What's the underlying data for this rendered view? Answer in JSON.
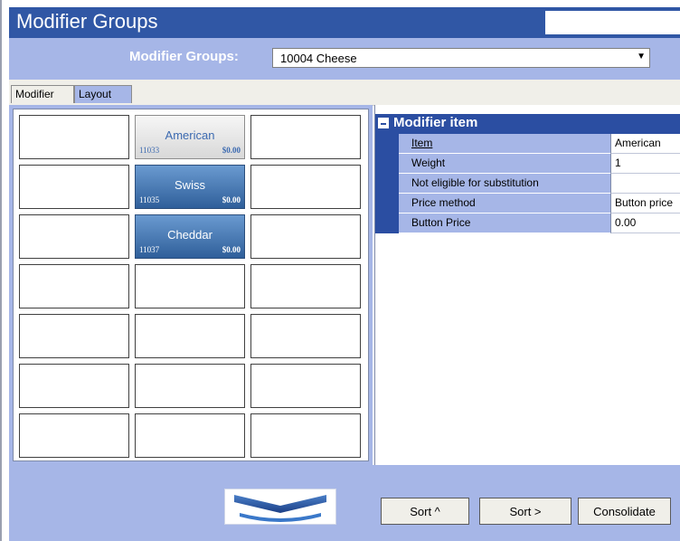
{
  "window": {
    "title": "Modifier Groups"
  },
  "selector": {
    "label": "Modifier Groups:",
    "value": "10004 Cheese"
  },
  "tabs": [
    {
      "label": "Modifier"
    },
    {
      "label": "Layout"
    }
  ],
  "grid": {
    "buttons": [
      {
        "name": "American",
        "code": "11033",
        "price": "$0.00"
      },
      {
        "name": "Swiss",
        "code": "11035",
        "price": "$0.00"
      },
      {
        "name": "Cheddar",
        "code": "11037",
        "price": "$0.00"
      }
    ]
  },
  "properties": {
    "header": "Modifier item",
    "rows": [
      {
        "name": "Item",
        "value": "American"
      },
      {
        "name": "Weight",
        "value": "1"
      },
      {
        "name": "Not eligible for substitution",
        "value": ""
      },
      {
        "name": "Price method",
        "value": "Button price"
      },
      {
        "name": "Button Price",
        "value": "0.00"
      }
    ]
  },
  "bottom": {
    "sort_up": "Sort ^",
    "sort_right": "Sort >",
    "consolidate": "Consolidate"
  },
  "icons": {
    "collapse": "minus-box-icon",
    "dropdown": "chevron-down-icon",
    "page": "double-chevron-down-icon"
  },
  "colors": {
    "titlebar": "#3057a5",
    "panel": "#a6b6e7",
    "button_blue": "#2f5f9a"
  }
}
